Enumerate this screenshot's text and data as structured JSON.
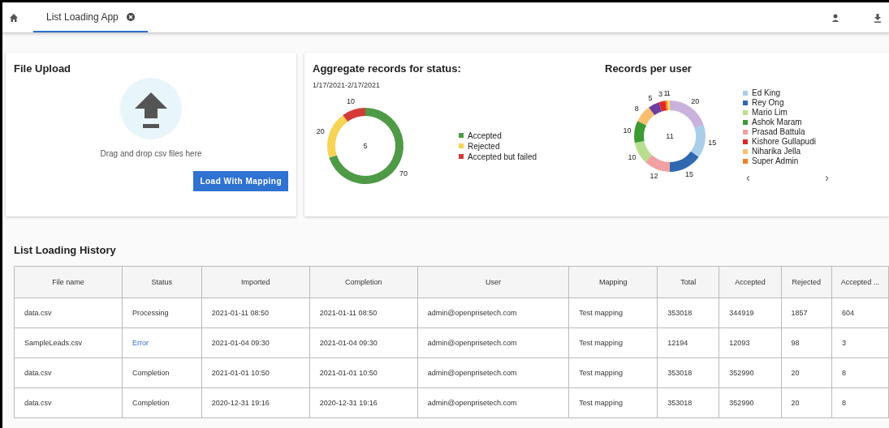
{
  "tabs": [
    {
      "label": "List Loading App",
      "selected": true
    }
  ],
  "file_upload": {
    "title": "File Upload",
    "hint": "Drag and drop csv files here",
    "button": "Load With Mapping"
  },
  "status_chart": {
    "title": "Aggregate records for status:",
    "date_range": "1/17/2021-2/17/2021",
    "center_label": "5",
    "chart_data": {
      "type": "donut",
      "categories": [
        "Accepted",
        "Rejected",
        "Accepted but failed"
      ],
      "values": [
        70,
        20,
        10
      ],
      "colors": [
        "#4e9a47",
        "#f7d456",
        "#d33c36"
      ],
      "value_labels": [
        "70",
        "20",
        "10"
      ]
    }
  },
  "user_chart": {
    "title": "Records per user",
    "center_label": "11",
    "chart_data": {
      "type": "donut",
      "values": [
        20,
        15,
        15,
        12,
        10,
        10,
        8,
        5,
        3,
        1,
        1
      ],
      "colors": [
        "#c9b3dd",
        "#a9cfe8",
        "#2f68b1",
        "#f1a1a4",
        "#b9de90",
        "#3c9a32",
        "#f8c06e",
        "#6a3fa0",
        "#e02628",
        "#f47e20",
        "#f5e15a"
      ],
      "value_labels": [
        "20",
        "15",
        "15",
        "12",
        "10",
        "10",
        "8",
        "5",
        "3",
        "1",
        "1"
      ]
    },
    "legend": [
      {
        "label": "Ed King",
        "color": "#a9cfe8"
      },
      {
        "label": "Rey Ong",
        "color": "#2f68b1"
      },
      {
        "label": "Mario Lim",
        "color": "#b9de90"
      },
      {
        "label": "Ashok Maram",
        "color": "#3c9a32"
      },
      {
        "label": "Prasad Battula",
        "color": "#f1a1a4"
      },
      {
        "label": "Kishore Gullapudi",
        "color": "#e02628"
      },
      {
        "label": "Niharika Jella",
        "color": "#f8c06e"
      },
      {
        "label": "Super Admin",
        "color": "#f47e20"
      }
    ],
    "prev": "‹",
    "next": "›"
  },
  "history": {
    "title": "List Loading History",
    "columns": [
      "File name",
      "Status",
      "Imported",
      "Completion",
      "User",
      "Mapping",
      "Total",
      "Accepted",
      "Rejected",
      "Accepted ..."
    ],
    "rows": [
      {
        "cells": [
          "data.csv",
          "Processing",
          "2021-01-11 08:50",
          "2021-01-11 08:50",
          "admin@openprisetech.com",
          "Test mapping",
          "353018",
          "344919",
          "1857",
          "604"
        ],
        "status_link": false
      },
      {
        "cells": [
          "SampleLeads.csv",
          "Error",
          "2021-01-04 09:30",
          "2021-01-04 09:30",
          "admin@openprisetech.com",
          "Test mapping",
          "12194",
          "12093",
          "98",
          "3"
        ],
        "status_link": true
      },
      {
        "cells": [
          "data.csv",
          "Completion",
          "2021-01-01 10:50",
          "2021-01-01 10:50",
          "admin@openprisetech.com",
          "Test mapping",
          "353018",
          "352990",
          "20",
          "8"
        ],
        "status_link": false
      },
      {
        "cells": [
          "data.csv",
          "Completion",
          "2020-12-31 19:16",
          "2020-12-31 19:16",
          "admin@openprisetech.com",
          "Test mapping",
          "353018",
          "352990",
          "20",
          "8"
        ],
        "status_link": false
      }
    ]
  }
}
